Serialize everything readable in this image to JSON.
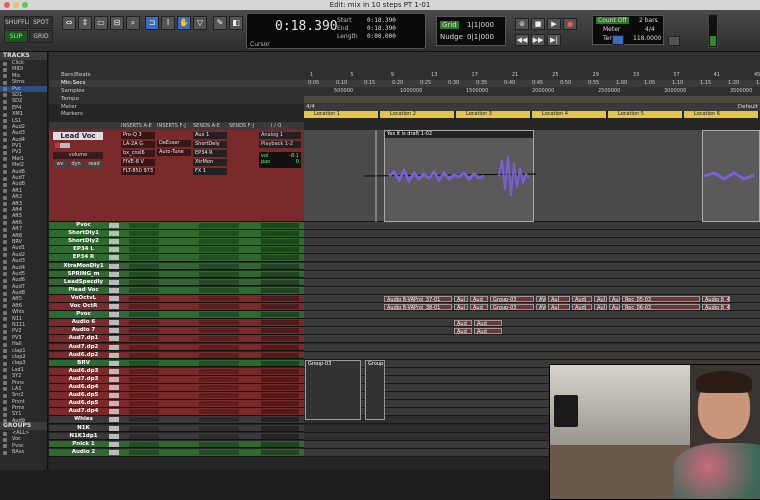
{
  "window": {
    "title": "Edit: mix in 10 steps PT 1-01"
  },
  "toolbar": {
    "modes": [
      "SHUFFLE",
      "SPOT",
      "SLIP",
      "GRID"
    ],
    "counter": {
      "main": "0:18.390",
      "start_label": "Start",
      "end_label": "End",
      "length_label": "Length",
      "start": "0:18.390",
      "end": "0:18.390",
      "length": "0:00.000",
      "cursor_label": "Cursor"
    },
    "grid_label": "Grid",
    "nudge_label": "Nudge",
    "grid_value": "1|1|000",
    "nudge_value": "0|1|000",
    "count_off": "Count Off",
    "bars": "2 bars",
    "meter_label": "Meter",
    "meter_value": "4/4",
    "tempo_label": "Tempo",
    "tempo_value": "118.0000"
  },
  "tracks_panel": {
    "header": "TRACKS",
    "items": [
      "Click",
      "MIDI",
      "Mic",
      "Stms",
      "Pvc",
      "SD1",
      "SD2",
      "EP4",
      "XM1",
      "LS1",
      "Aud2",
      "Aud3",
      "Aud4",
      "PV1",
      "PV2",
      "Mel1",
      "Mel2",
      "Aud6",
      "Aud7",
      "Aud8",
      "Aft1",
      "Aft2",
      "Aft3",
      "Aft4",
      "Aft5",
      "Aft6",
      "Aft7",
      "Aft8",
      "BRV",
      "Aud1",
      "Aud2",
      "Aud3",
      "Aud4",
      "Aud5",
      "Aud6",
      "Aud7",
      "Aud8",
      "Aft5",
      "Aft6",
      "Whls",
      "N11",
      "N111",
      "PV2",
      "PV3",
      "Hall",
      "clap1",
      "clap2",
      "clap3",
      "Lsd1",
      "SY2",
      "Pnns",
      "LA1",
      "Snr2",
      "Prsnt",
      "Prms",
      "SY1",
      "Aud9",
      "Drms",
      "GV1",
      "Aud0",
      "LS07",
      "SY2",
      "N22",
      "Bass"
    ],
    "groups_header": "GROUPS",
    "groups": [
      "<ALL>",
      "Voc",
      "Pvoc",
      "BAss"
    ]
  },
  "rulers": {
    "names": [
      "Bars|Beats",
      "Min:Secs",
      "Samples",
      "Tempo",
      "Meter",
      "Markers"
    ],
    "bars": [
      "1",
      "5",
      "9",
      "13",
      "17",
      "21",
      "25",
      "29",
      "33",
      "37",
      "41",
      "45"
    ],
    "secs": [
      "0:05",
      "0:10",
      "0:15",
      "0:20",
      "0:25",
      "0:30",
      "0:35",
      "0:40",
      "0:45",
      "0:50",
      "0:55",
      "1:00",
      "1:05",
      "1:10",
      "1:15",
      "1:20",
      "1:25"
    ],
    "samples": [
      "500000",
      "1000000",
      "1500000",
      "2000000",
      "2500000",
      "3000000",
      "3500000"
    ],
    "meter_left": "4/4",
    "meter_right": "Default",
    "locations": [
      "Location 1",
      "Location 2",
      "Location 3",
      "Location 4",
      "Location 5",
      "Location 6"
    ]
  },
  "columns": {
    "inserts_ae": "INSERTS A-E",
    "inserts_fj": "INSERTS F-J",
    "sends_ae": "SENDS A-E",
    "sends_fj": "SENDS F-J",
    "io": "I / O"
  },
  "lead_voc": {
    "name": "Lead Voc",
    "view": "volume",
    "wave_btn": "wv",
    "dyn_btn": "dyn",
    "read_btn": "read",
    "inserts": [
      "Pro-Q 3",
      "LA-2A G",
      "bx_cnsl6",
      "FIVE-8 V",
      "FLT-850 973"
    ],
    "inserts_fj": [
      "DeEsser",
      "Auto-Tune"
    ],
    "sends": [
      "Aux 1",
      "ShortDely",
      "EP34 R",
      "XtrMon",
      "FX 1"
    ],
    "io": [
      "Analog 1",
      "Playback 1-2"
    ],
    "vol_label": "vol",
    "vol_value": "-8.1",
    "pan_label": "pan",
    "pan_value": "0",
    "clip_name": "Yes It is draft 1-02"
  },
  "tracks": [
    {
      "name": "Pvoc",
      "color": "#2e6a2e"
    },
    {
      "name": "ShortDly1",
      "color": "#2e6a2e"
    },
    {
      "name": "ShortDly2",
      "color": "#2e6a2e"
    },
    {
      "name": "EP34 L",
      "color": "#2e6a2e"
    },
    {
      "name": "EP34 R",
      "color": "#2e6a2e"
    },
    {
      "name": "XtraMonDly1",
      "color": "#2e6a2e"
    },
    {
      "name": "SPRING_m",
      "color": "#2e6a2e"
    },
    {
      "name": "LeadSpecdly",
      "color": "#2e6a2e"
    },
    {
      "name": "Plead Voc",
      "color": "#2e6a2e"
    },
    {
      "name": "VoOctvL",
      "color": "#7a2a2a"
    },
    {
      "name": "Voc OctR",
      "color": "#7a2a2a"
    },
    {
      "name": "Pvoc",
      "color": "#2e6a2e"
    },
    {
      "name": "Audio 6",
      "color": "#7a2a2a"
    },
    {
      "name": "Audio 7",
      "color": "#7a2a2a"
    },
    {
      "name": "Aud7.dp1",
      "color": "#7a2a2a"
    },
    {
      "name": "Aud7.dp2",
      "color": "#7a2a2a"
    },
    {
      "name": "Aud6.dp2",
      "color": "#7a2a2a"
    },
    {
      "name": "BRV",
      "color": "#2e6a2e"
    },
    {
      "name": "Aud6.dp3",
      "color": "#7a2a2a"
    },
    {
      "name": "Aud7.dp3",
      "color": "#7a2a2a"
    },
    {
      "name": "Aud6.dp4",
      "color": "#7a2a2a"
    },
    {
      "name": "Aud6.dp5",
      "color": "#7a2a2a"
    },
    {
      "name": "Aud6.dp5",
      "color": "#7a2a2a"
    },
    {
      "name": "Aud7.dp4",
      "color": "#7a2a2a"
    },
    {
      "name": "Whles",
      "color": "#3a3a3a"
    },
    {
      "name": "N1K",
      "color": "#3a3a3a"
    },
    {
      "name": "N1K1dp1",
      "color": "#3a3a3a"
    },
    {
      "name": "Pnick 1",
      "color": "#2e6a2e"
    },
    {
      "name": "Audio 2",
      "color": "#2e6a2e"
    }
  ],
  "clips": {
    "row9": [
      "Audio 8-VAProj_37-01",
      "Aul",
      "Aud",
      "Group-03",
      "AV",
      "Aul",
      "Audi",
      "Aul",
      "Aul",
      "Rec_05-03",
      "Audio 8_47-01"
    ],
    "row10": [
      "Audio 8-VAProj_38-01",
      "Aul",
      "Aud",
      "Group-03",
      "AV",
      "Aul",
      "Audi",
      "Aul",
      "Aul",
      "Rec_06-03",
      "Audio 8_47-01"
    ],
    "row12": [
      "Aud",
      "Aud"
    ],
    "row13": [
      "Aud",
      "Aud"
    ],
    "groups_low": [
      "Group-03",
      "Group-"
    ]
  },
  "colors": {
    "accent_blue": "#3a6cc4",
    "marker_yellow": "#e4c64a",
    "waveform": "#7b5fd6",
    "track_red": "#7a2a2a",
    "track_green": "#2e6a2e"
  }
}
